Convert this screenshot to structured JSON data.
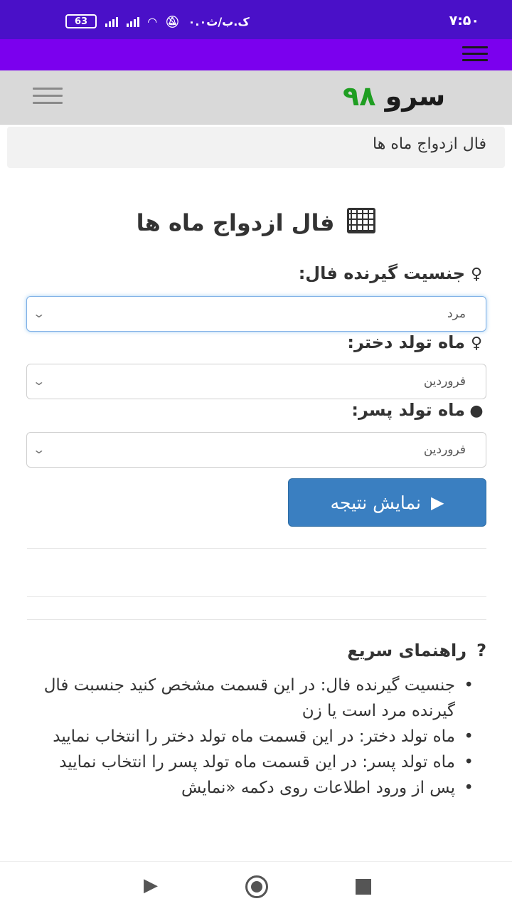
{
  "status_bar": {
    "time": "۷:۵۰",
    "battery": "63",
    "carrier_text": "۰.۰ک.ب/ث"
  },
  "header": {
    "logo_text": "سرو",
    "logo_number": "۹۸"
  },
  "breadcrumb": {
    "current": "فال ازدواج ماه ها"
  },
  "form": {
    "title": "فال ازدواج ماه ها",
    "gender_label": "جنسیت گیرنده فال:",
    "gender_value": "مرد",
    "girl_month_label": "ماه تولد دختر:",
    "girl_month_value": "فروردین",
    "boy_month_label": "ماه تولد پسر:",
    "boy_month_value": "فروردین",
    "submit_label": "نمایش نتیجه"
  },
  "guide": {
    "title": "راهنمای سریع",
    "items": [
      "جنسیت گیرنده فال: در این قسمت مشخص کنید جنسبت فال گیرنده مرد است یا زن",
      "ماه تولد دختر: در این قسمت ماه تولد دختر را انتخاب نمایید",
      "ماه تولد پسر: در این قسمت ماه تولد پسر را انتخاب نمایید",
      "پس از ورود اطلاعات روی دکمه «نمایش"
    ]
  },
  "colors": {
    "status_bar": "#4a10c8",
    "app_bar": "#7b00ee",
    "header_bg": "#d9d9d9",
    "logo_green": "#1f9e22",
    "button": "#3a7fc1"
  },
  "icons": {
    "title": "calculator-icon",
    "gender": "female-icon",
    "girl": "female-icon",
    "boy": "user-icon",
    "submit": "play-icon",
    "guide": "question-icon"
  }
}
